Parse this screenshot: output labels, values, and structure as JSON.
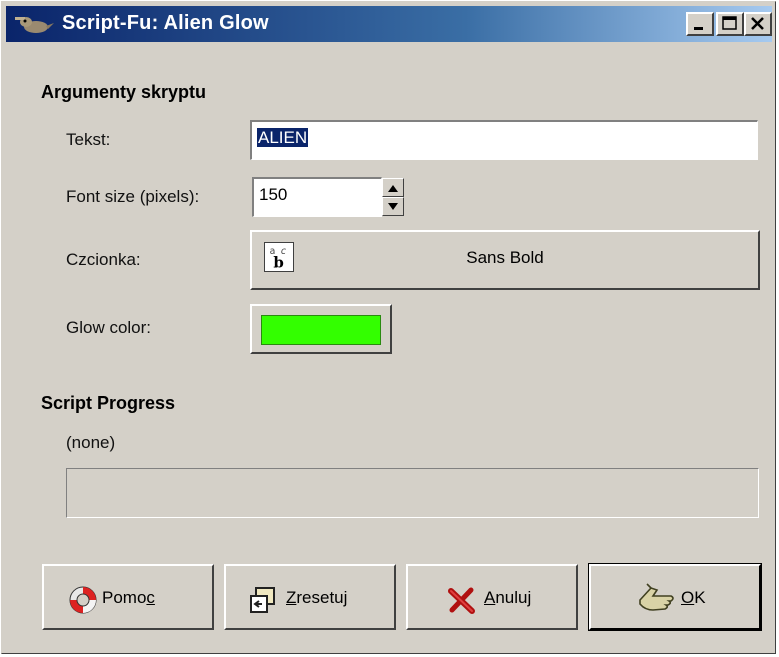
{
  "window": {
    "title": "Script-Fu: Alien Glow",
    "controls": [
      "minimize",
      "maximize",
      "close"
    ]
  },
  "args_section": {
    "heading": "Argumenty skryptu"
  },
  "fields": {
    "text_label": "Tekst:",
    "text_value": "ALIEN",
    "font_size_label": "Font size (pixels):",
    "font_size_value": "150",
    "font_label": "Czcionka:",
    "font_value": "Sans Bold",
    "glow_label": "Glow color:",
    "glow_color": "#33ff00"
  },
  "progress_section": {
    "heading": "Script Progress",
    "status": "(none)"
  },
  "buttons": {
    "help": {
      "pre": "Pomo",
      "mnemonic": "c",
      "post": "",
      "icon": "lifebuoy-icon"
    },
    "reset": {
      "pre": "",
      "mnemonic": "Z",
      "post": "resetuj",
      "icon": "reset-icon"
    },
    "cancel": {
      "pre": "",
      "mnemonic": "A",
      "post": "nuluj",
      "icon": "cancel-x-icon"
    },
    "ok": {
      "pre": "",
      "mnemonic": "O",
      "post": "K",
      "icon": "ok-hand-icon"
    }
  }
}
